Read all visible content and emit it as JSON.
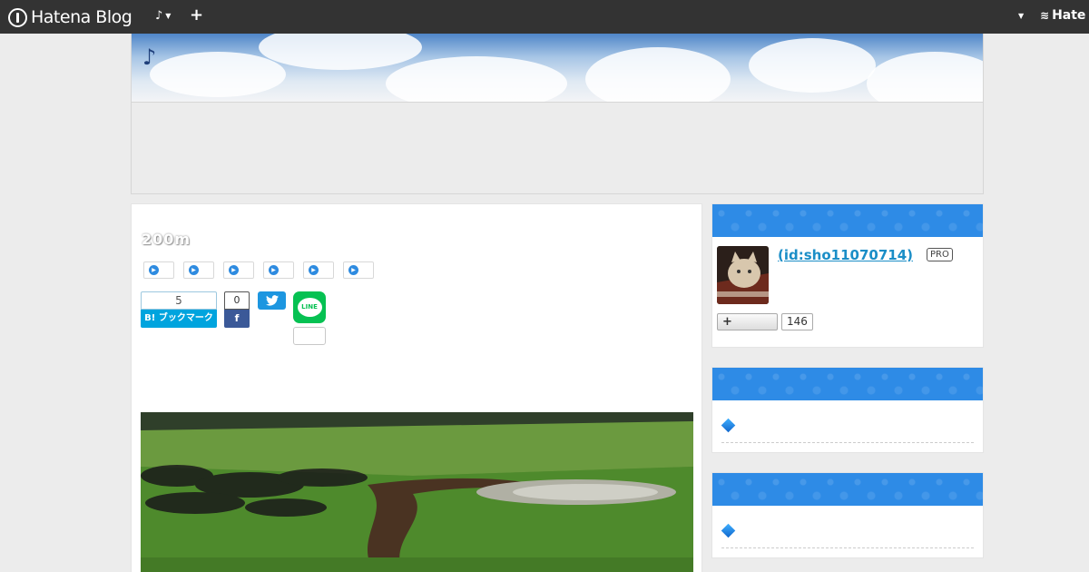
{
  "globalbar": {
    "brand": "Hatena Blog",
    "blog_menu_label": "♪",
    "plus_label": "+",
    "right_logo": "Hate"
  },
  "blog": {
    "title": "♪"
  },
  "entry": {
    "title": "200m",
    "category_count": 6,
    "share": {
      "bookmark_count": "5",
      "bookmark_label": "B! ブックマーク",
      "facebook_count": "0",
      "facebook_icon": "f",
      "line_label": "LINE"
    }
  },
  "sidebar": {
    "profile": {
      "name": " (id:sho11070714)",
      "badge": "PRO",
      "follow_label": "+",
      "follow_count": "146"
    }
  },
  "colors": {
    "globalbar": "#333333",
    "accent": "#2e8be6",
    "hatena_bookmark": "#00a4de",
    "facebook": "#3b5998",
    "twitter": "#1d96e0",
    "line": "#06c152"
  },
  "icons": {
    "logo": "hatena-logo-icon",
    "plus": "plus-icon",
    "caret": "caret-down-icon",
    "twitter": "twitter-icon",
    "line": "line-icon",
    "category": "play-circle-icon",
    "list_bullet": "diamond-icon"
  }
}
